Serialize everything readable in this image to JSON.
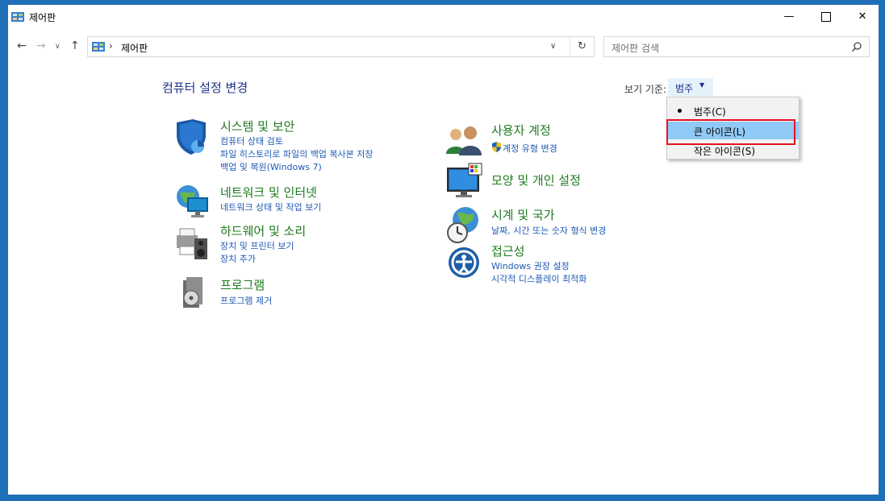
{
  "window": {
    "title": "제어판",
    "minimize_icon": "minimize-icon",
    "maximize_icon": "maximize-icon",
    "close_icon": "close-icon"
  },
  "navigation": {
    "back_icon": "arrow-left-icon",
    "forward_icon": "arrow-right-icon",
    "recent_icon": "chevron-down-icon",
    "up_icon": "arrow-up-icon",
    "address_crumb": "제어판",
    "search_placeholder": "제어판 검색",
    "refresh_icon": "refresh-icon"
  },
  "content": {
    "page_title": "컴퓨터 설정 변경",
    "view_by_label": "보기 기준:",
    "view_by_value": "범주"
  },
  "categories": [
    {
      "title": "시스템 및 보안",
      "icon": "shield-icon",
      "links": [
        "컴퓨터 상태 검토",
        "파일 히스토리로 파일의 백업 복사본 저장",
        "백업 및 복원(Windows 7)"
      ]
    },
    {
      "title": "네트워크 및 인터넷",
      "icon": "network-globe-icon",
      "links": [
        "네트워크 상태 및 작업 보기"
      ]
    },
    {
      "title": "하드웨어 및 소리",
      "icon": "printer-speaker-icon",
      "links": [
        "장치 및 프린터 보기",
        "장치 추가"
      ]
    },
    {
      "title": "프로그램",
      "icon": "programs-disc-icon",
      "links": [
        "프로그램 제거"
      ]
    },
    {
      "title": "사용자 계정",
      "icon": "users-icon",
      "links": [
        "계정 유형 변경"
      ]
    },
    {
      "title": "모양 및 개인 설정",
      "icon": "monitor-palette-icon",
      "links": []
    },
    {
      "title": "시계 및 국가",
      "icon": "clock-globe-icon",
      "links": [
        "날짜, 시간 또는 숫자 형식 변경"
      ]
    },
    {
      "title": "접근성",
      "icon": "ease-of-access-icon",
      "links": [
        "Windows 권장 설정",
        "시각적 디스플레이 최적화"
      ]
    }
  ],
  "view_menu": {
    "items": [
      {
        "label": "범주(C)",
        "selected": true
      },
      {
        "label": "큰 아이콘(L)",
        "selected": false,
        "hovered": true
      },
      {
        "label": "작은 아이콘(S)",
        "selected": false
      }
    ]
  },
  "colors": {
    "category_title": "#1e7a1e",
    "link": "#1f5bb5",
    "page_title": "#1e3287",
    "menu_hover": "#91c9f7",
    "highlight": "#e81123"
  }
}
